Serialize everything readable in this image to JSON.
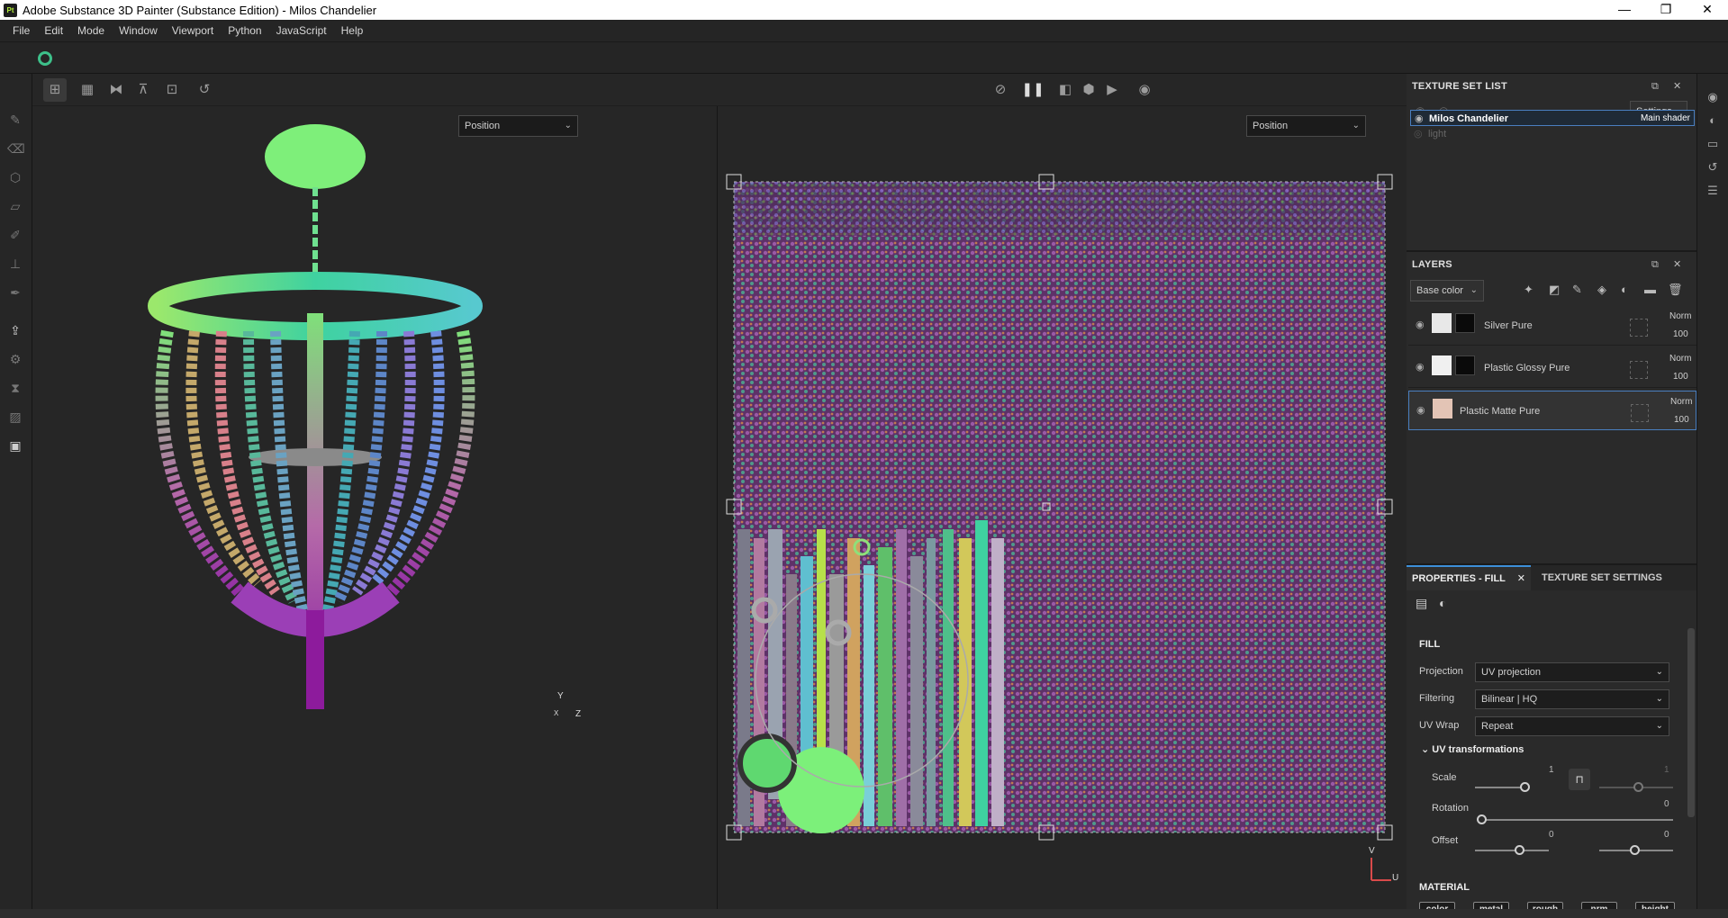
{
  "window": {
    "logo_text": "Pt",
    "title": "Adobe Substance 3D Painter (Substance Edition) - Milos Chandelier",
    "minimize": "—",
    "maximize": "❐",
    "close": "✕"
  },
  "menu": [
    "File",
    "Edit",
    "Mode",
    "Window",
    "Viewport",
    "Python",
    "JavaScript",
    "Help"
  ],
  "viewport_3d": {
    "channel": "Position",
    "axis_y": "Y",
    "axis_z": "Z",
    "axis_x": "X"
  },
  "viewport_2d": {
    "channel": "Position",
    "axis_v": "V",
    "axis_u": "U"
  },
  "texture_set_list": {
    "title": "TEXTURE SET LIST",
    "settings_label": "Settings",
    "items": [
      {
        "name": "Milos Chandelier",
        "shader": "Main shader",
        "active": true
      },
      {
        "name": "light",
        "shader": "",
        "active": false
      }
    ]
  },
  "layers": {
    "title": "LAYERS",
    "channel": "Base color",
    "items": [
      {
        "name": "Silver Pure",
        "blend": "Norm",
        "opacity": "100"
      },
      {
        "name": "Plastic Glossy Pure",
        "blend": "Norm",
        "opacity": "100"
      },
      {
        "name": "Plastic Matte Pure",
        "blend": "Norm",
        "opacity": "100"
      }
    ]
  },
  "properties": {
    "tab_fill": "PROPERTIES - FILL",
    "tab_tss": "TEXTURE SET SETTINGS",
    "section_fill": "FILL",
    "projection_label": "Projection",
    "projection_value": "UV projection",
    "filtering_label": "Filtering",
    "filtering_value": "Bilinear | HQ",
    "uvwrap_label": "UV Wrap",
    "uvwrap_value": "Repeat",
    "uvtrans_label": "UV transformations",
    "scale_label": "Scale",
    "scale_value": "1",
    "scale_value2": "1",
    "rotation_label": "Rotation",
    "rotation_value": "0",
    "offset_label": "Offset",
    "offset_value": "0",
    "offset_value2": "0",
    "section_material": "MATERIAL",
    "material_chips": [
      "color",
      "metal",
      "rough",
      "nrm",
      "height"
    ]
  }
}
